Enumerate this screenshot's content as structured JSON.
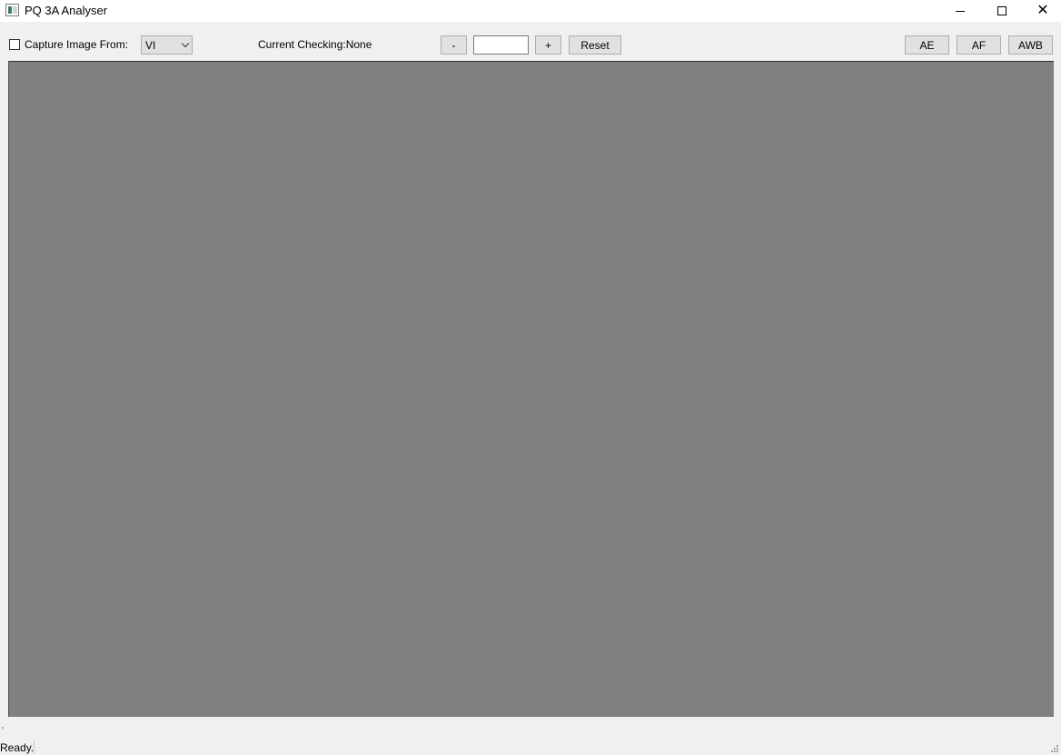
{
  "window": {
    "title": "PQ 3A Analyser",
    "controls": {
      "minimize": "minimize-icon",
      "maximize": "maximize-icon",
      "close": "close-icon"
    }
  },
  "toolbar": {
    "capture_checkbox_label": "Capture Image From:",
    "capture_checked": false,
    "source_select_value": "VI",
    "current_checking": "Current Checking:None",
    "minus_label": "-",
    "value_field": "",
    "plus_label": "+",
    "reset_label": "Reset",
    "ae_label": "AE",
    "af_label": "AF",
    "awb_label": "AWB"
  },
  "viewport": {
    "background": "#808080"
  },
  "status": {
    "text": "Ready."
  }
}
